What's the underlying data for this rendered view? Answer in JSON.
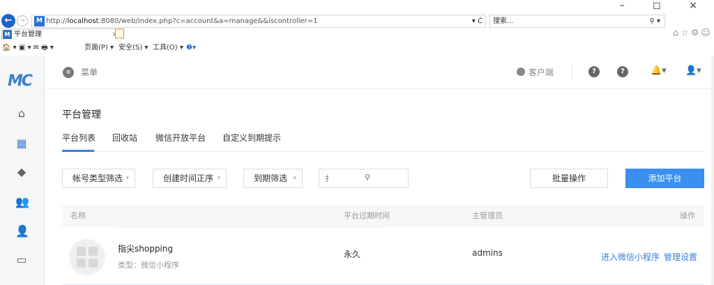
{
  "browser": {
    "url_prefix": "http://",
    "url_host": "localhost",
    "url_rest": ":8080/web/index.php?c=account&a=manage&&iscontroller=1",
    "addr_ctrl": "▾ Ċ",
    "search_label": "搜索...",
    "search_ctrl": "⚲ ▾",
    "tab_title": "平台管理",
    "tab_close": "×",
    "cmd_page": "页面(P) ▾",
    "cmd_safety": "安全(S) ▾",
    "cmd_tools": "工具(O) ▾",
    "cmd_left": "🏠 ▾ ▣ ▾ ✉ 🖶 ▾",
    "win_ctrl": "– ◻ ×",
    "tb_icons": "⌂☆⚙☺"
  },
  "app": {
    "logo": "MC",
    "menu_label": "菜单",
    "client_label": "客户端",
    "page_title": "平台管理",
    "tabs": [
      "平台列表",
      "回收站",
      "微信开放平台",
      "自定义到期提示"
    ],
    "filters": [
      "帐号类型筛选",
      "创建时间正序",
      "到期筛选"
    ],
    "search_placeholder": "扌",
    "batch_button": "批量操作",
    "add_button": "添加平台",
    "columns": [
      "名称",
      "平台过期时间",
      "主管理员",
      "操作"
    ],
    "row": {
      "name": "指尖shopping",
      "type": "类型：微信小程序",
      "expire": "永久",
      "admin": "admins",
      "action_enter": "进入微信小程序",
      "action_manage": "管理设置"
    }
  },
  "colors": {
    "accent": "#3a7fd5",
    "primary_button": "#3b8ff0"
  }
}
